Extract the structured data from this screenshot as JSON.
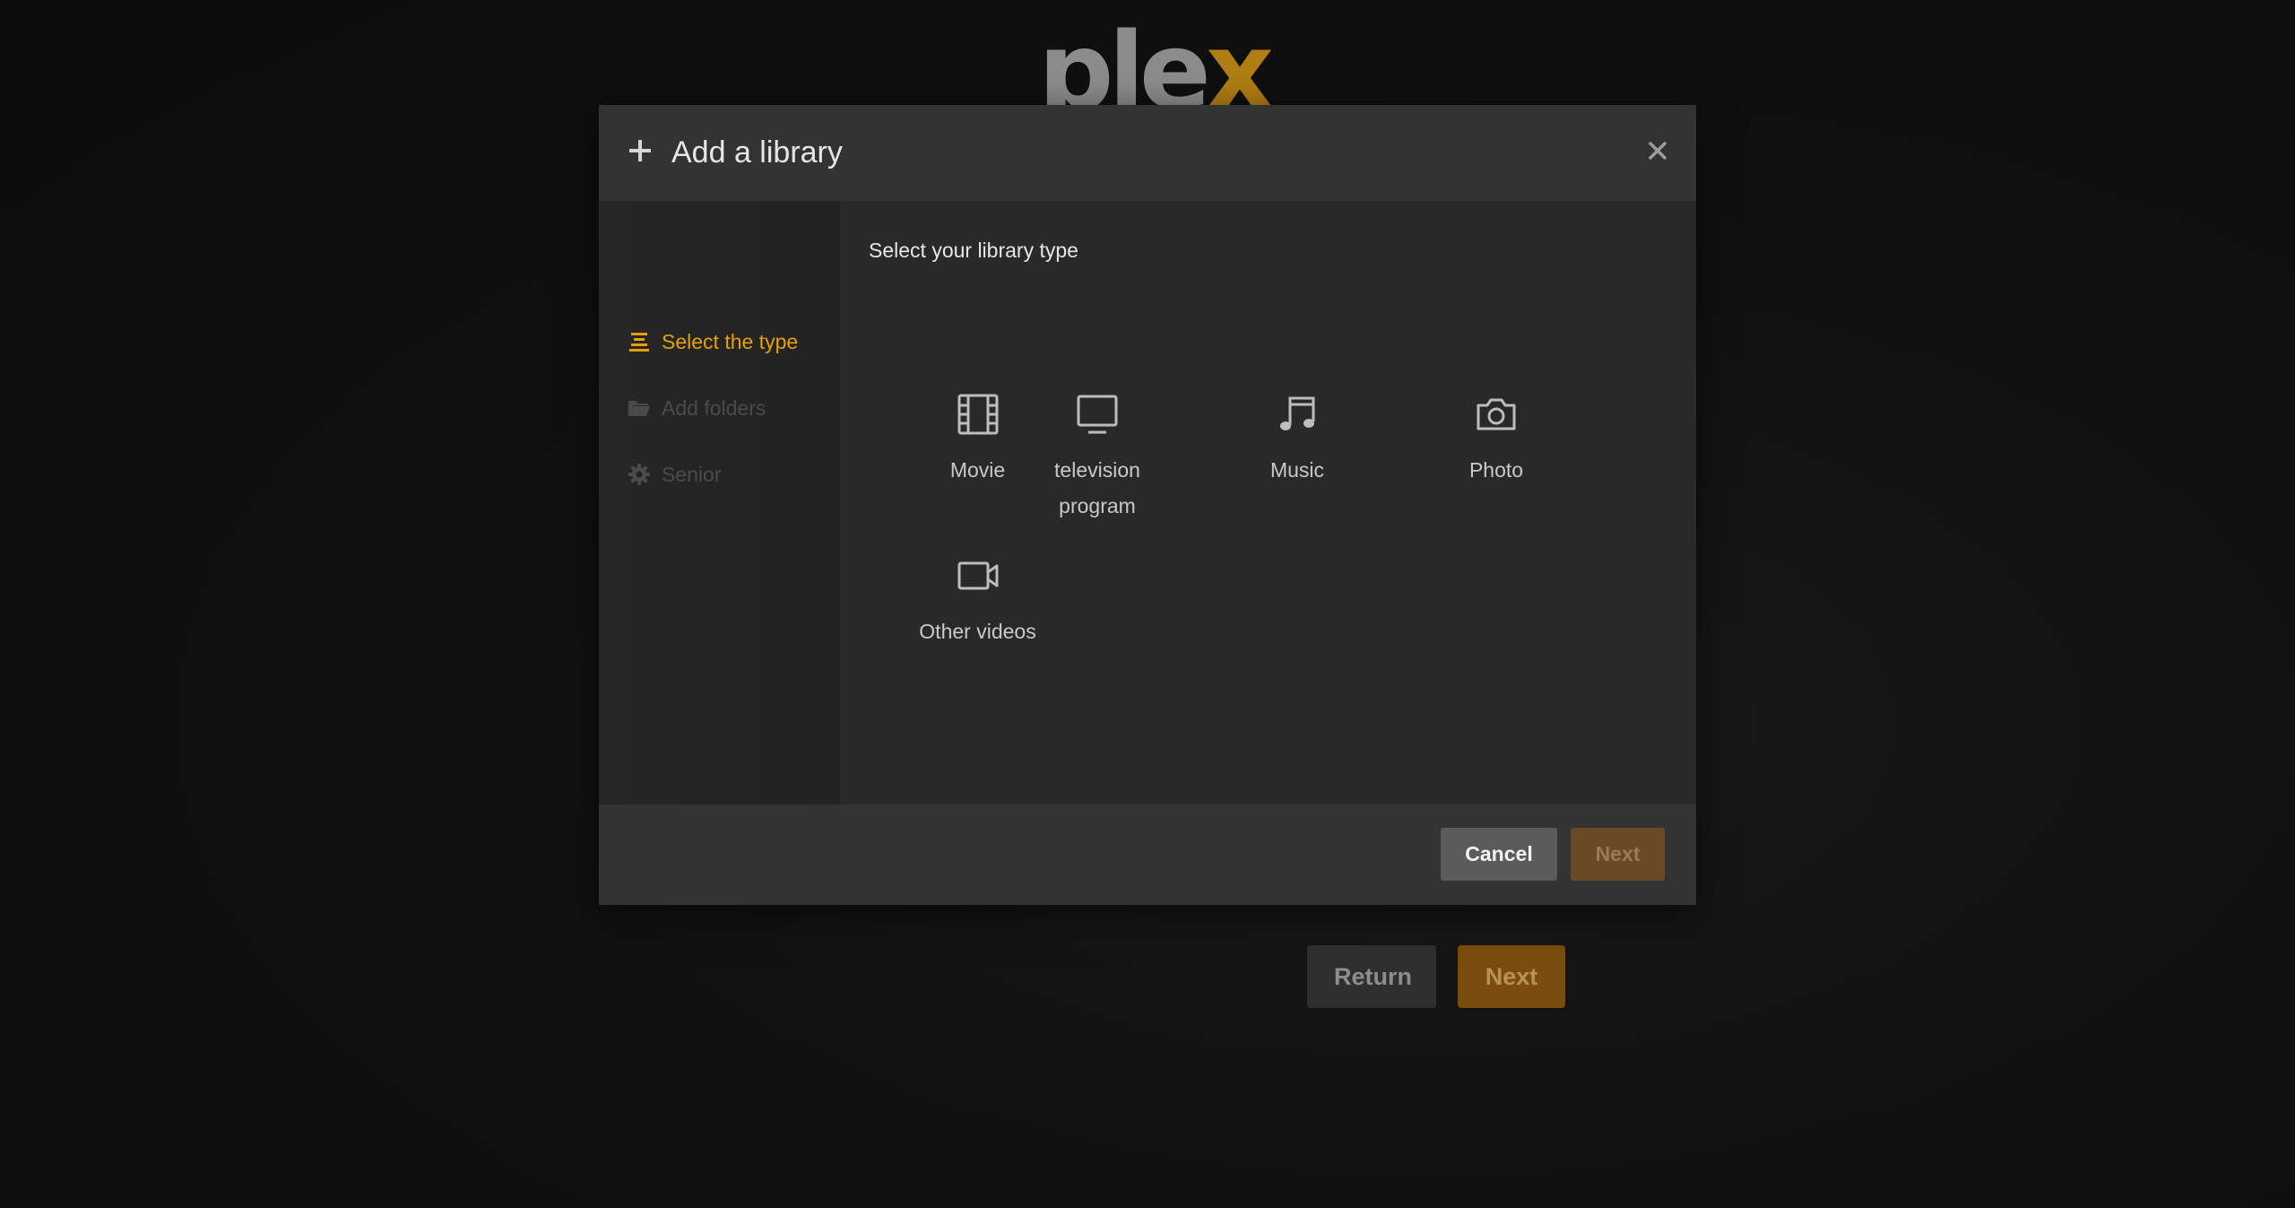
{
  "logo": {
    "text_main": "ple",
    "text_accent": "x"
  },
  "background_buttons": {
    "return_label": "Return",
    "next_label": "Next"
  },
  "modal": {
    "title": "Add a library",
    "sidebar": {
      "items": [
        {
          "label": "Select the type",
          "icon": "list-icon",
          "state": "active"
        },
        {
          "label": "Add folders",
          "icon": "folder-icon",
          "state": "disabled"
        },
        {
          "label": "Senior",
          "icon": "gear-icon",
          "state": "disabled"
        }
      ]
    },
    "content": {
      "title": "Select your library type",
      "types": [
        {
          "label": "Movie",
          "icon": "film-icon"
        },
        {
          "label": "television program",
          "icon": "tv-icon"
        },
        {
          "label": "Music",
          "icon": "music-note-icon"
        },
        {
          "label": "Photo",
          "icon": "camera-icon"
        },
        {
          "label": "Other videos",
          "icon": "video-camera-icon"
        }
      ]
    },
    "footer": {
      "cancel_label": "Cancel",
      "next_label": "Next"
    }
  },
  "colors": {
    "accent": "#e5a00d",
    "modal_header": "#333333",
    "modal_body": "#292929",
    "cancel_button": "#5b5b5b",
    "next_button_disabled": "#6a4a26"
  }
}
